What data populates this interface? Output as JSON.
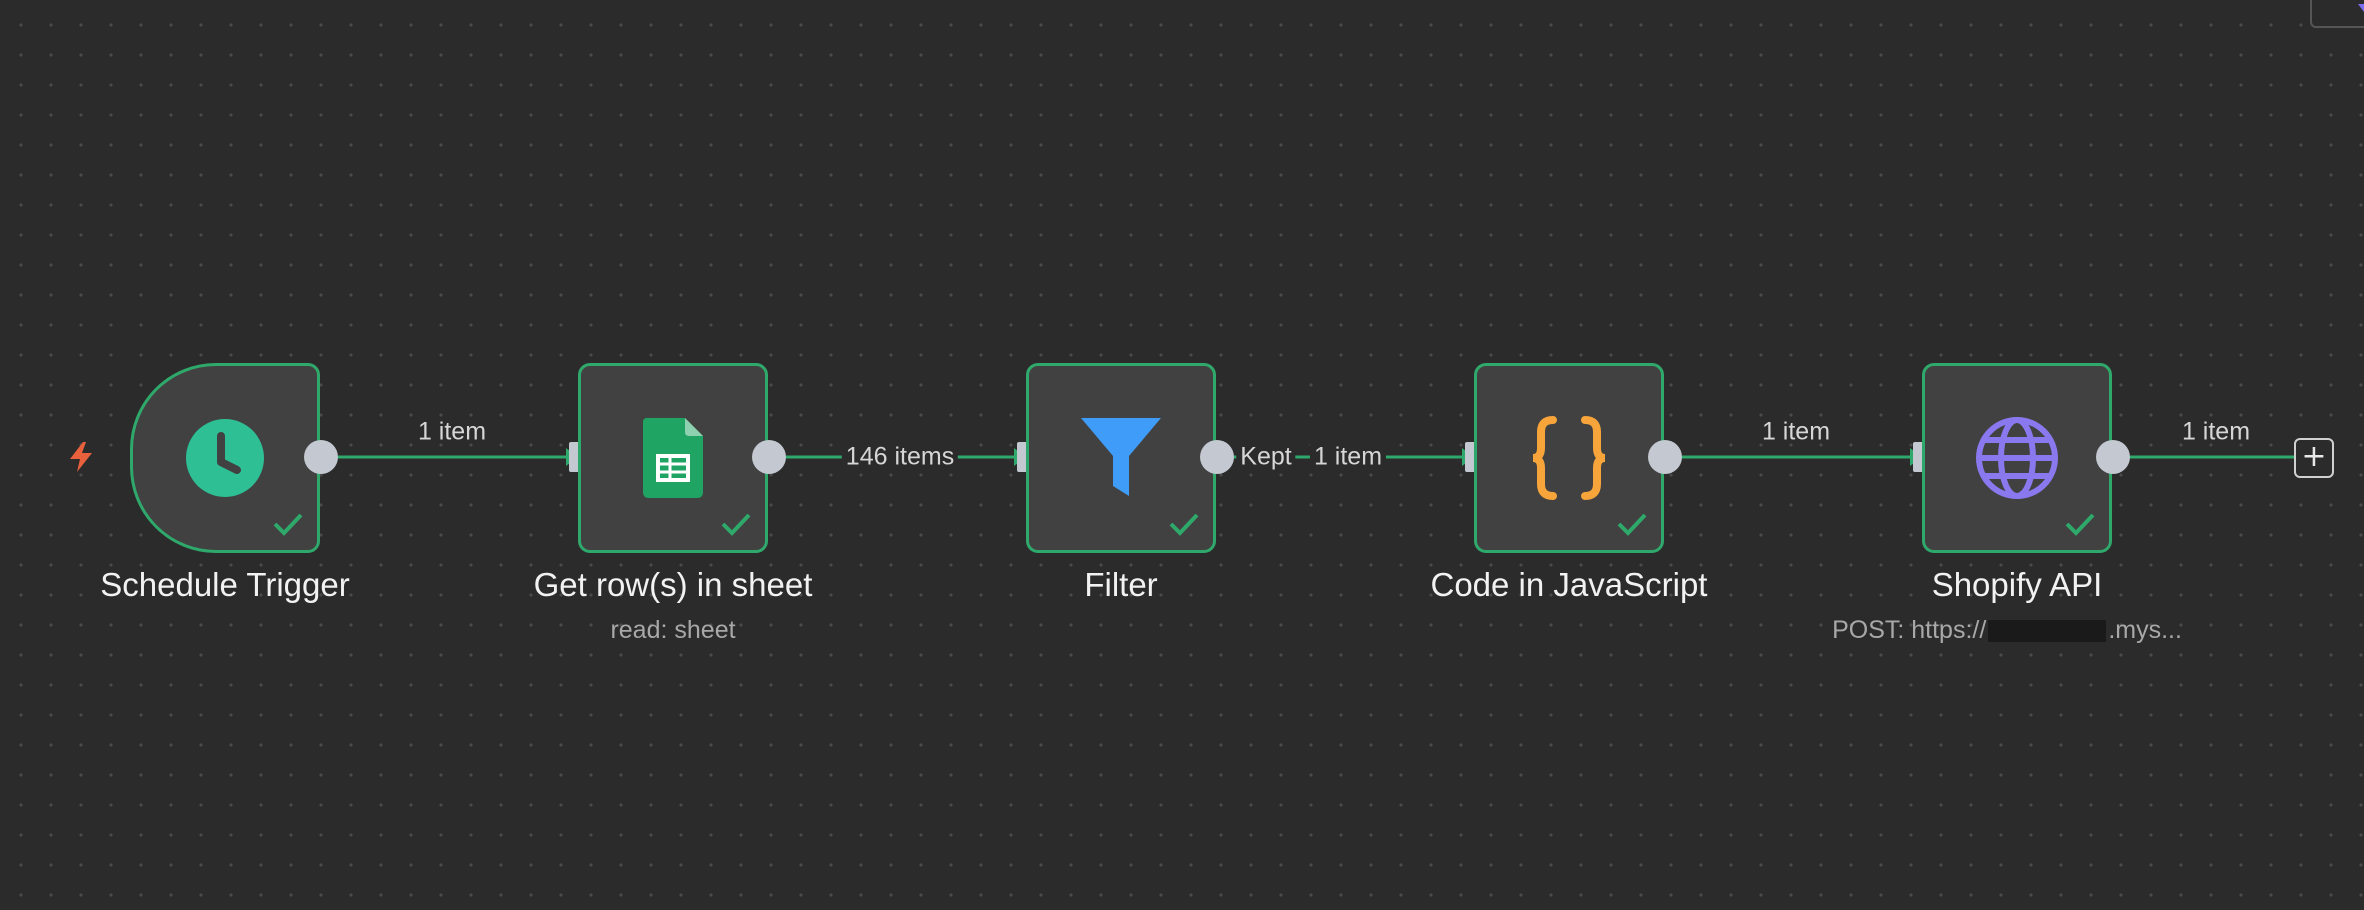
{
  "colors": {
    "canvas": "#2b2b2b",
    "node_fill": "#414141",
    "success_border": "#2fa86b",
    "connection": "#2fa86b",
    "port": "#c4c8d0",
    "trigger_bolt": "#e8603c"
  },
  "nodes": [
    {
      "id": "schedule-trigger",
      "label": "Schedule Trigger",
      "subtitle": "",
      "icon": "clock-icon",
      "status": "success"
    },
    {
      "id": "get-rows",
      "label": "Get row(s) in sheet",
      "subtitle": "read: sheet",
      "icon": "google-sheets-icon",
      "status": "success"
    },
    {
      "id": "filter",
      "label": "Filter",
      "subtitle": "",
      "icon": "funnel-icon",
      "status": "success"
    },
    {
      "id": "code",
      "label": "Code in JavaScript",
      "subtitle": "",
      "icon": "code-braces-icon",
      "status": "success"
    },
    {
      "id": "shopify-api",
      "label": "Shopify API",
      "subtitle_prefix": "POST: https://",
      "subtitle_suffix": ".mys...",
      "icon": "globe-icon",
      "status": "success"
    }
  ],
  "connections": [
    {
      "from": "schedule-trigger",
      "to": "get-rows",
      "label": "1 item"
    },
    {
      "from": "get-rows",
      "to": "filter",
      "label": "146 items"
    },
    {
      "from": "filter",
      "to": "code",
      "branch": "Kept",
      "label": "1 item"
    },
    {
      "from": "code",
      "to": "shopify-api",
      "label": "1 item"
    },
    {
      "from": "shopify-api",
      "to": "add-node",
      "label": "1 item"
    }
  ],
  "add_node": {
    "symbol": "+"
  }
}
